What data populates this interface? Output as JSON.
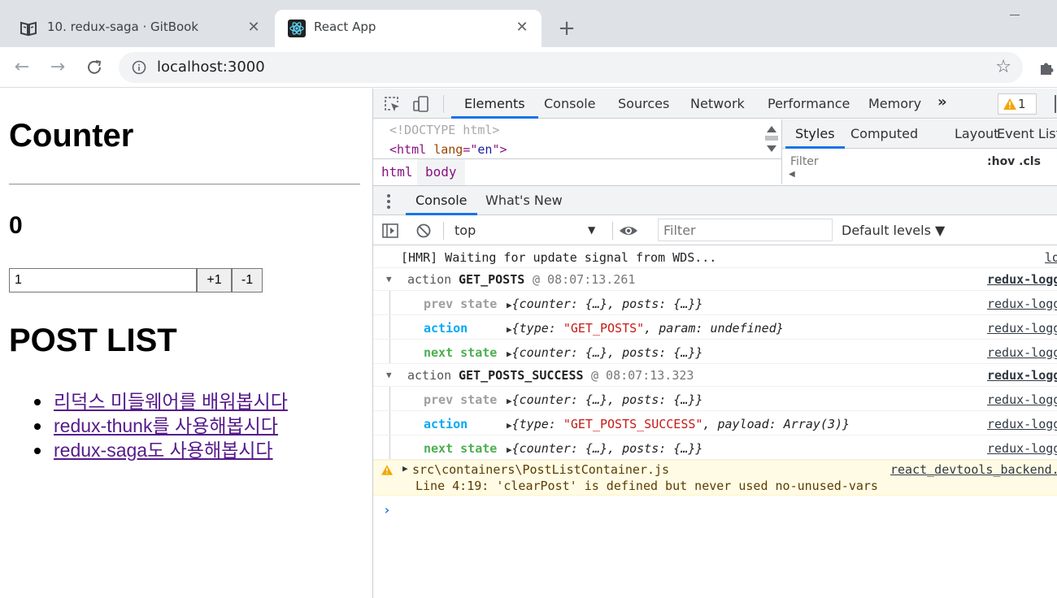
{
  "browser": {
    "tabs": [
      {
        "title": "10. redux-saga · GitBook"
      },
      {
        "title": "React App"
      }
    ],
    "url": "localhost:3000"
  },
  "page": {
    "counter_title": "Counter",
    "count": "0",
    "step_value": "1",
    "plus_label": "+1",
    "minus_label": "-1",
    "post_list_title": "POST LIST",
    "posts": [
      "리덕스 미들웨어를 배워봅시다",
      "redux-thunk를 사용해봅시다",
      "redux-saga도 사용해봅시다"
    ]
  },
  "devtools": {
    "tabs": [
      "Elements",
      "Console",
      "Sources",
      "Network",
      "Performance",
      "Memory"
    ],
    "more": "»",
    "warning_count": "1",
    "elements": {
      "doctype": "<!DOCTYPE html>",
      "html_tag_open": "<html",
      "html_attr_name": "lang",
      "html_attr_eq": "=\"",
      "html_attr_value": "en",
      "html_tag_close": "\">",
      "breadcrumbs": [
        "html",
        "body"
      ]
    },
    "styles": {
      "tabs": [
        "Styles",
        "Computed",
        "Layout",
        "Event Liste"
      ],
      "filter_placeholder": "Filter",
      "hov": ":hov .cls"
    },
    "drawer_tabs": [
      "Console",
      "What's New"
    ],
    "console_toolbar": {
      "context": "top",
      "filter_placeholder": "Filter",
      "levels": "Default levels ▼"
    },
    "log": {
      "hmr": "[HMR] Waiting for update signal from WDS...",
      "hmr_src": "lo",
      "group1": {
        "label": "action",
        "type": "GET_POSTS",
        "time": "@ 08:07:13.261",
        "src": "redux-logg"
      },
      "group1_rows": [
        {
          "key": "prev state",
          "value": "{counter: {…}, posts: {…}}",
          "src": "redux-logg"
        },
        {
          "key": "action",
          "value_pre": "{type: ",
          "value_str": "\"GET_POSTS\"",
          "value_post": ", param: undefined}",
          "src": "redux-logg"
        },
        {
          "key": "next state",
          "value": "{counter: {…}, posts: {…}}",
          "src": "redux-logg"
        }
      ],
      "group2": {
        "label": "action",
        "type": "GET_POSTS_SUCCESS",
        "time": "@ 08:07:13.323",
        "src": "redux-logg"
      },
      "group2_rows": [
        {
          "key": "prev state",
          "value": "{counter: {…}, posts: {…}}",
          "src": "redux-logg"
        },
        {
          "key": "action",
          "value_pre": "{type: ",
          "value_str": "\"GET_POSTS_SUCCESS\"",
          "value_post": ", payload: Array(3)}",
          "src": "redux-logg"
        },
        {
          "key": "next state",
          "value": "{counter: {…}, posts: {…}}",
          "src": "redux-logg"
        }
      ],
      "warning": {
        "file": "src\\containers\\PostListContainer.js",
        "src": "react_devtools_backend.",
        "message": "Line 4:19:  'clearPost' is defined but never used  no-unused-vars"
      },
      "prompt": "›"
    }
  }
}
